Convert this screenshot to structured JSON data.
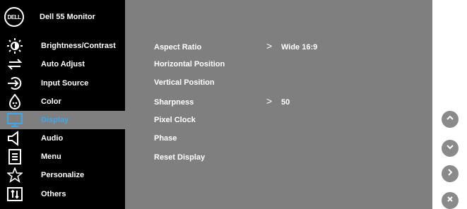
{
  "header": {
    "logo_text": "DELL",
    "title": "Dell 55 Monitor"
  },
  "colors": {
    "sidebar": "#000000",
    "panel": "#7f7f7f",
    "active": "#3fa7e8",
    "text": "#ffffff"
  },
  "sidebar": {
    "items": [
      {
        "label": "Brightness/Contrast",
        "icon": "brightness-icon"
      },
      {
        "label": "Auto Adjust",
        "icon": "auto-adjust-icon"
      },
      {
        "label": "Input Source",
        "icon": "input-source-icon"
      },
      {
        "label": "Color",
        "icon": "color-palette-icon"
      },
      {
        "label": "Display",
        "icon": "display-icon",
        "active": true
      },
      {
        "label": "Audio",
        "icon": "speaker-icon"
      },
      {
        "label": "Menu",
        "icon": "menu-icon"
      },
      {
        "label": "Personalize",
        "icon": "star-icon"
      },
      {
        "label": "Others",
        "icon": "others-icon"
      }
    ]
  },
  "display_options": [
    {
      "label": "Aspect Ratio",
      "value": "Wide 16:9"
    },
    {
      "label": "Horizontal Position"
    },
    {
      "label": "Vertical Position"
    },
    {
      "label": "Sharpness",
      "value": "50"
    },
    {
      "label": "Pixel Clock"
    },
    {
      "label": "Phase"
    },
    {
      "label": "Reset Display"
    }
  ],
  "nav_buttons": [
    "up-icon",
    "down-icon",
    "right-icon",
    "close-icon"
  ],
  "arrow_glyph": ">"
}
